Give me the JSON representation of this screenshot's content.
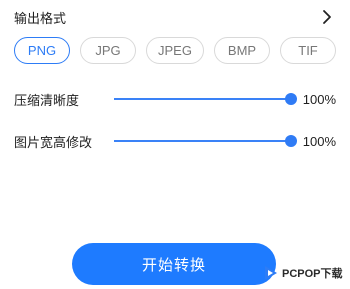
{
  "header": {
    "title": "输出格式",
    "chevron_icon": "chevron-right-icon"
  },
  "formats": {
    "options": [
      "PNG",
      "JPG",
      "JPEG",
      "BMP",
      "TIF"
    ],
    "selected": "PNG"
  },
  "settings": [
    {
      "label": "压缩清晰度",
      "value": 100,
      "value_text": "100%"
    },
    {
      "label": "图片宽高修改",
      "value": 100,
      "value_text": "100%"
    }
  ],
  "action": {
    "convert_label": "开始转换"
  },
  "watermark": {
    "text": "PCPOP下载"
  },
  "colors": {
    "accent": "#2D7CF6",
    "button": "#1E7BFF",
    "track": "#D0D0D0",
    "chip_border": "#D9D9D9"
  }
}
